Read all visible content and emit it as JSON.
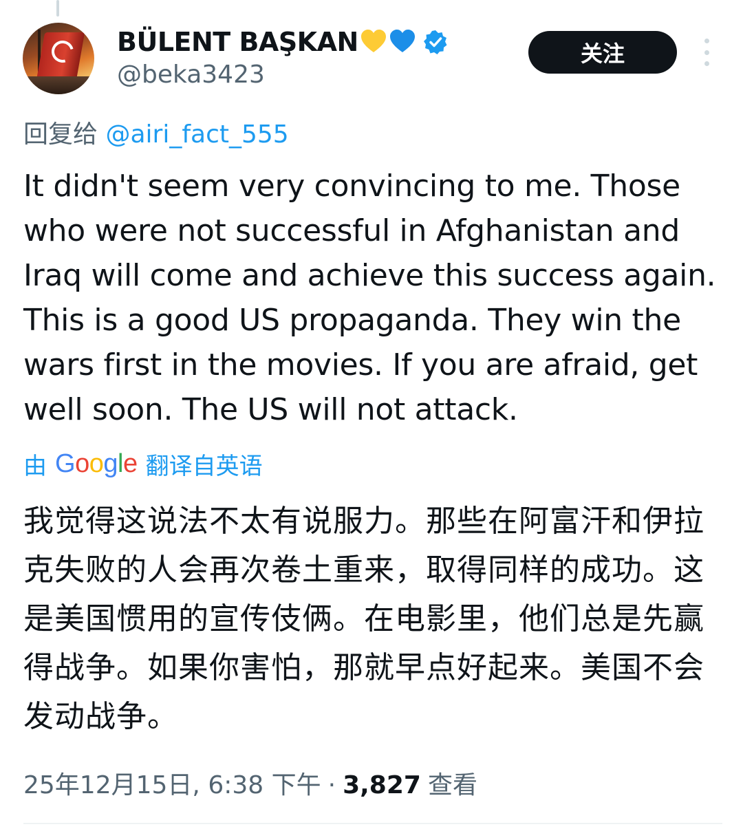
{
  "author": {
    "display_name": "BÜLENT BAŞKAN",
    "handle": "@beka3423",
    "badges": [
      "yellow-heart",
      "blue-heart",
      "verified-badge"
    ],
    "verified_color": "#1d9bf0"
  },
  "actions": {
    "follow_label": "关注",
    "more_icon": "more-vertical-icon"
  },
  "reply": {
    "prefix": "回复给",
    "mention": "@airi_fact_555"
  },
  "tweet": {
    "text": "It didn't seem very convincing to me. Those who were not successful in Afghanistan and Iraq will come and achieve this success again. This is a good US propaganda. They win the wars first in the movies. If you are afraid, get well soon. The US will not attack."
  },
  "translation": {
    "prefix": "由",
    "provider": "Google",
    "suffix": "翻译自英语",
    "text": "我觉得这说法不太有说服力。那些在阿富汗和伊拉克失败的人会再次卷土重来，取得同样的成功。这是美国惯用的宣传伎俩。在电影里，他们总是先赢得战争。如果你害怕，那就早点好起来。美国不会发动战争。"
  },
  "meta": {
    "timestamp": "25年12月15日, 6:38 下午",
    "separator": "·",
    "views_count": "3,827",
    "views_label": "查看"
  },
  "colors": {
    "text": "#0f1419",
    "secondary": "#536471",
    "link": "#1d9bf0",
    "follow_bg": "#0f1419"
  }
}
